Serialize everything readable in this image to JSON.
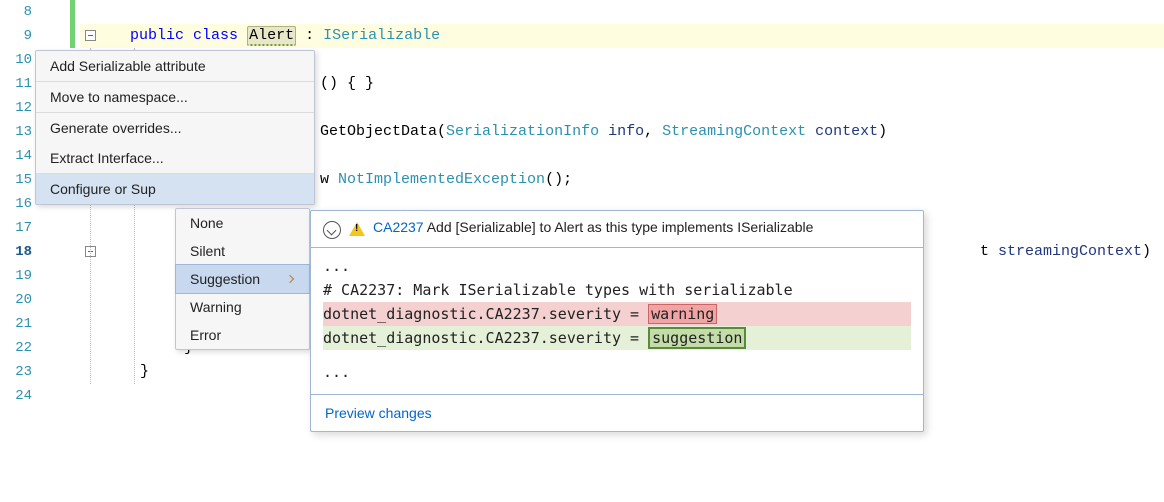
{
  "line_numbers": [
    "8",
    "9",
    "10",
    "11",
    "12",
    "13",
    "14",
    "15",
    "16",
    "17",
    "18",
    "19",
    "20",
    "21",
    "22",
    "23",
    "24"
  ],
  "current_line": "18",
  "code": {
    "l9_public": "public",
    "l9_class": "class",
    "l9_alert": "Alert",
    "l9_colon": " : ",
    "l9_iser": "ISerializable",
    "l11_tail": "() { }",
    "l13_get": "GetObjectData",
    "l13_p1t": "SerializationInfo",
    "l13_p1n": " info",
    "l13_c": ", ",
    "l13_p2t": "StreamingContext",
    "l13_p2n": " context",
    "l13_close": ")",
    "l15_w": "w ",
    "l15_ex": "NotImplementedException",
    "l15_tail": "();",
    "l18_tail": "t ",
    "l18_param": "streamingContext",
    "l18_close": ")",
    "l22_brace": "}",
    "l23_brace": "}"
  },
  "menu1": {
    "i1": "Add Serializable attribute",
    "i2": "Move to namespace...",
    "i3": "Generate overrides...",
    "i4": "Extract Interface...",
    "i5": "Configure or Sup"
  },
  "menu2": {
    "i1": "None",
    "i2": "Silent",
    "i3": "Suggestion",
    "i4": "Warning",
    "i5": "Error"
  },
  "preview": {
    "rule": "CA2237",
    "title_rest": " Add [Serializable] to Alert as this type implements ISerializable",
    "dots1": "...",
    "comment": "# CA2237: Mark ISerializable types with serializable",
    "del_line_pre": "dotnet_diagnostic.CA2237.severity = ",
    "del_box": "warning",
    "add_line_pre": "dotnet_diagnostic.CA2237.severity = ",
    "add_box": "suggestion",
    "dots2": "...",
    "link": "Preview changes"
  }
}
